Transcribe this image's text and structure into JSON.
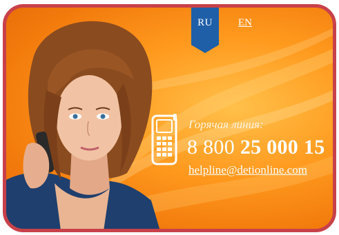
{
  "lang": {
    "ru": "RU",
    "en": "EN",
    "active": "RU"
  },
  "hotline": {
    "label": "Горячая линия:",
    "number_prefix": "8 800",
    "number_main": "25 000 15",
    "email": "helpline@detionline.com"
  },
  "colors": {
    "frame_border": "#c8414a",
    "background": "#f78b14",
    "lang_tab": "#1f5fa8",
    "text": "#ffffff"
  },
  "icons": {
    "phone": "mobile-phone-icon"
  }
}
